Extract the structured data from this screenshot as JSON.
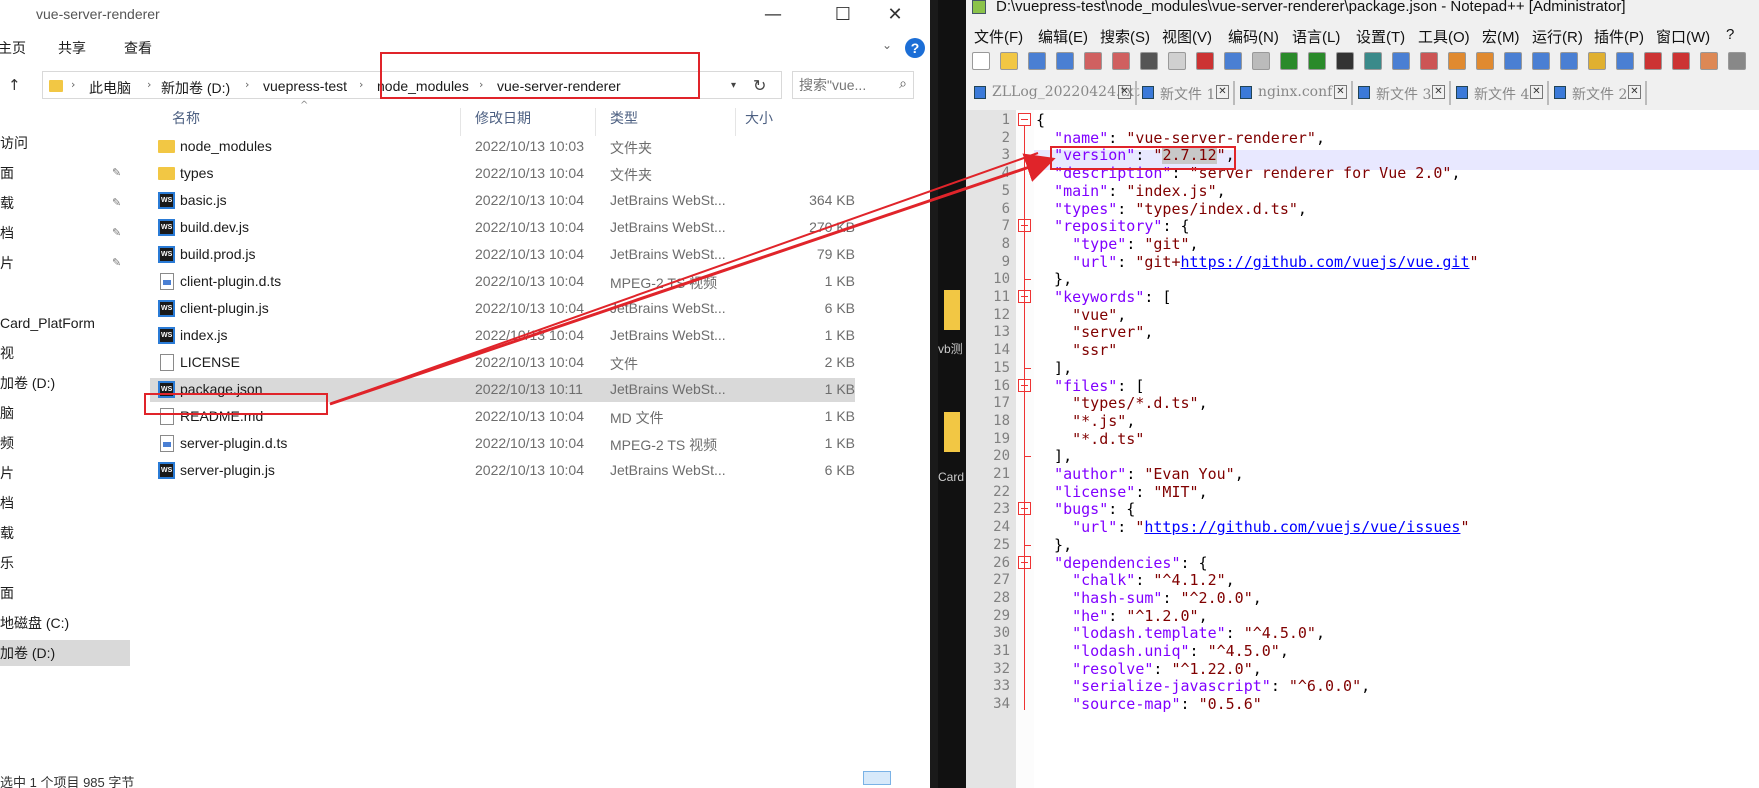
{
  "explorer": {
    "title": "vue-server-renderer",
    "ribbon": {
      "home": "主页",
      "share": "共享",
      "view": "查看"
    },
    "breadcrumb": [
      "此电脑",
      "新加卷 (D:)",
      "vuepress-test",
      "node_modules",
      "vue-server-renderer"
    ],
    "search_placeholder": "搜索\"vue...",
    "nav_items": [
      {
        "label": "访问",
        "pin": false
      },
      {
        "label": "面",
        "pin": true
      },
      {
        "label": "载",
        "pin": true
      },
      {
        "label": "档",
        "pin": true
      },
      {
        "label": "片",
        "pin": true
      },
      {
        "label": "Card_PlatForm",
        "pin": false
      },
      {
        "label": "视",
        "pin": false
      },
      {
        "label": "加卷 (D:)",
        "pin": false
      },
      {
        "label": "脑",
        "pin": false
      },
      {
        "label": "频",
        "pin": false
      },
      {
        "label": "片",
        "pin": false
      },
      {
        "label": "档",
        "pin": false
      },
      {
        "label": "载",
        "pin": false
      },
      {
        "label": "乐",
        "pin": false
      },
      {
        "label": "面",
        "pin": false
      },
      {
        "label": "地磁盘 (C:)",
        "pin": false
      },
      {
        "label": "加卷 (D:)",
        "pin": false
      }
    ],
    "columns": {
      "name": "名称",
      "date": "修改日期",
      "type": "类型",
      "size": "大小"
    },
    "files": [
      {
        "name": "node_modules",
        "date": "2022/10/13 10:03",
        "type": "文件夹",
        "size": "",
        "icon": "folder"
      },
      {
        "name": "types",
        "date": "2022/10/13 10:04",
        "type": "文件夹",
        "size": "",
        "icon": "folder"
      },
      {
        "name": "basic.js",
        "date": "2022/10/13 10:04",
        "type": "JetBrains WebSt...",
        "size": "364 KB",
        "icon": "ws"
      },
      {
        "name": "build.dev.js",
        "date": "2022/10/13 10:04",
        "type": "JetBrains WebSt...",
        "size": "270 KB",
        "icon": "ws"
      },
      {
        "name": "build.prod.js",
        "date": "2022/10/13 10:04",
        "type": "JetBrains WebSt...",
        "size": "79 KB",
        "icon": "ws"
      },
      {
        "name": "client-plugin.d.ts",
        "date": "2022/10/13 10:04",
        "type": "MPEG-2 TS 视频",
        "size": "1 KB",
        "icon": "ts"
      },
      {
        "name": "client-plugin.js",
        "date": "2022/10/13 10:04",
        "type": "JetBrains WebSt...",
        "size": "6 KB",
        "icon": "ws"
      },
      {
        "name": "index.js",
        "date": "2022/10/13 10:04",
        "type": "JetBrains WebSt...",
        "size": "1 KB",
        "icon": "ws"
      },
      {
        "name": "LICENSE",
        "date": "2022/10/13 10:04",
        "type": "文件",
        "size": "2 KB",
        "icon": "doc"
      },
      {
        "name": "package.json",
        "date": "2022/10/13 10:11",
        "type": "JetBrains WebSt...",
        "size": "1 KB",
        "icon": "ws",
        "selected": true
      },
      {
        "name": "README.md",
        "date": "2022/10/13 10:04",
        "type": "MD 文件",
        "size": "1 KB",
        "icon": "doc"
      },
      {
        "name": "server-plugin.d.ts",
        "date": "2022/10/13 10:04",
        "type": "MPEG-2 TS 视频",
        "size": "1 KB",
        "icon": "ts"
      },
      {
        "name": "server-plugin.js",
        "date": "2022/10/13 10:04",
        "type": "JetBrains WebSt...",
        "size": "6 KB",
        "icon": "ws"
      }
    ],
    "status": "选中 1 个项目  985 字节"
  },
  "desktop_strip": {
    "label1": "vb测",
    "label2": "Card"
  },
  "notepad": {
    "title": "D:\\vuepress-test\\node_modules\\vue-server-renderer\\package.json - Notepad++ [Administrator]",
    "menu": [
      "文件(F)",
      "编辑(E)",
      "搜索(S)",
      "视图(V)",
      "编码(N)",
      "语言(L)",
      "设置(T)",
      "工具(O)",
      "宏(M)",
      "运行(R)",
      "插件(P)",
      "窗口(W)",
      "?"
    ],
    "tabs": [
      "ZLLog_20220424.txt",
      "新文件 1",
      "nginx.conf",
      "新文件 3",
      "新文件 4",
      "新文件 2"
    ],
    "lines": [
      "{",
      "  \"name\": \"vue-server-renderer\",",
      "  \"version\": \"2.7.12\",",
      "  \"description\": \"server renderer for Vue 2.0\",",
      "  \"main\": \"index.js\",",
      "  \"types\": \"types/index.d.ts\",",
      "  \"repository\": {",
      "    \"type\": \"git\",",
      "    \"url\": \"git+https://github.com/vuejs/vue.git\"",
      "  },",
      "  \"keywords\": [",
      "    \"vue\",",
      "    \"server\",",
      "    \"ssr\"",
      "  ],",
      "  \"files\": [",
      "    \"types/*.d.ts\",",
      "    \"*.js\",",
      "    \"*.d.ts\"",
      "  ],",
      "  \"author\": \"Evan You\",",
      "  \"license\": \"MIT\",",
      "  \"bugs\": {",
      "    \"url\": \"https://github.com/vuejs/vue/issues\"",
      "  },",
      "  \"dependencies\": {",
      "    \"chalk\": \"^4.1.2\",",
      "    \"hash-sum\": \"^2.0.0\",",
      "    \"he\": \"^1.2.0\",",
      "    \"lodash.template\": \"^4.5.0\",",
      "    \"lodash.uniq\": \"^4.5.0\",",
      "    \"resolve\": \"^1.22.0\",",
      "    \"serialize-javascript\": \"^6.0.0\",",
      "    \"source-map\": \"0.5.6\""
    ],
    "highlighted_value": "2.7.12"
  },
  "colors": {
    "annotation_red": "#e0242a",
    "json_key": "#8000ff",
    "json_string": "#800000",
    "url": "#0000ff",
    "selection": "#d9d9d9"
  }
}
